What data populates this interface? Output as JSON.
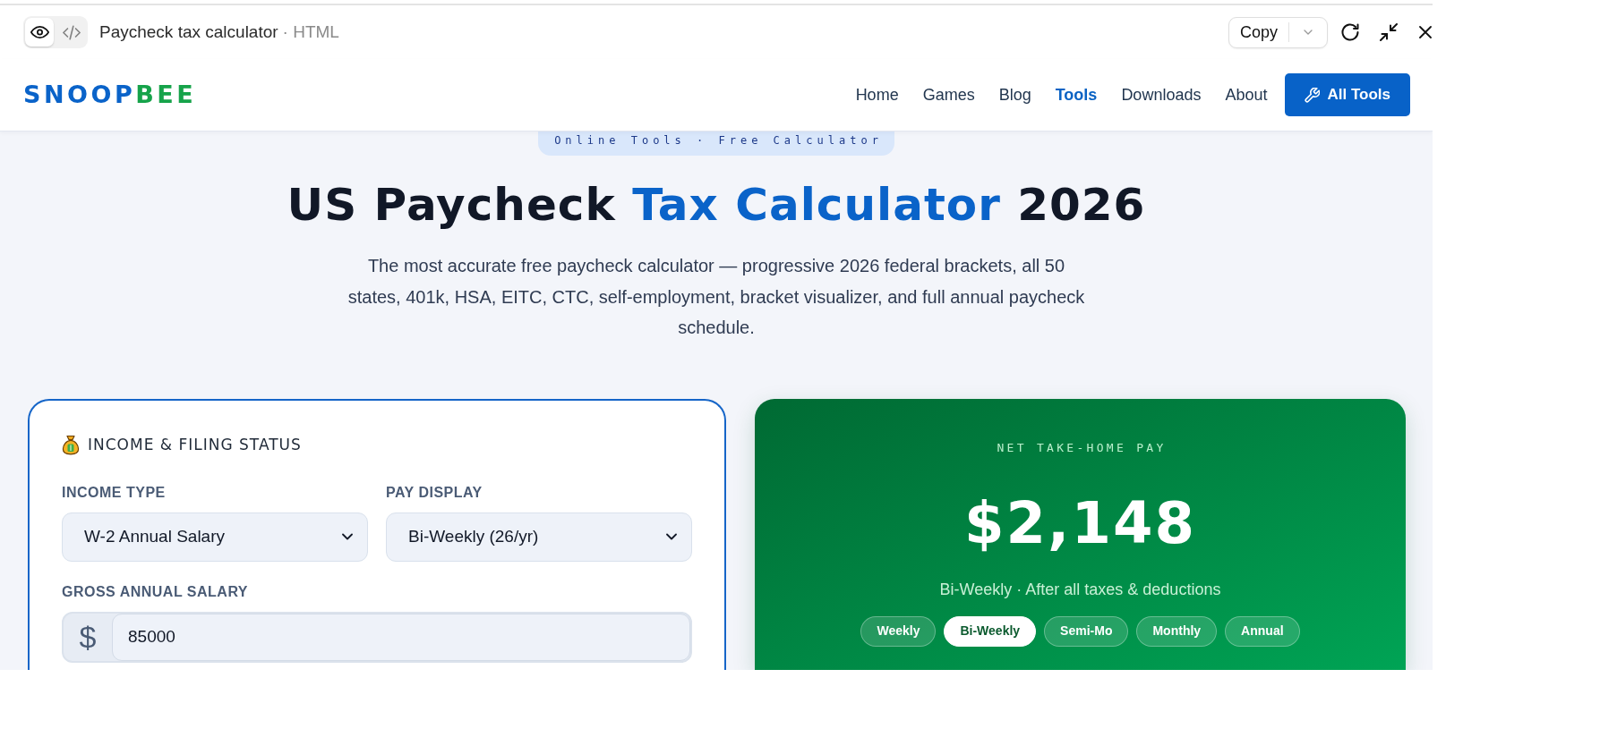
{
  "toolbar": {
    "view_modes": [
      {
        "kind": "preview",
        "selected": true
      },
      {
        "kind": "code",
        "selected": false
      }
    ],
    "title": "Paycheck tax calculator",
    "file_type": "· HTML",
    "copy_label": "Copy"
  },
  "nav": {
    "logo": [
      {
        "text": "SNOOP",
        "color": "#0a63c9"
      },
      {
        "text": "BEE",
        "color": "#16a34a"
      }
    ],
    "links": [
      {
        "label": "Home",
        "selected": false
      },
      {
        "label": "Games",
        "selected": false
      },
      {
        "label": "Blog",
        "selected": false
      },
      {
        "label": "Tools",
        "selected": true
      },
      {
        "label": "Downloads",
        "selected": false
      },
      {
        "label": "About",
        "selected": false
      }
    ],
    "cta": "All Tools"
  },
  "hero": {
    "badge": "Online Tools · Free Calculator",
    "title": [
      {
        "text": "US Paycheck",
        "highlight": false
      },
      {
        "text": "Tax Calculator",
        "highlight": true
      },
      {
        "text": "2026",
        "highlight": false
      }
    ],
    "subtitle": "The most accurate free paycheck calculator — progressive 2026 federal brackets, all 50 states, 401k, HSA, EITC, CTC, self-employment, bracket visualizer, and full annual paycheck schedule."
  },
  "income_card": {
    "heading": "INCOME & FILING STATUS",
    "fields": [
      {
        "kind": "select",
        "label": "INCOME TYPE",
        "value": "W-2 Annual Salary"
      },
      {
        "kind": "select",
        "label": "PAY DISPLAY",
        "value": "Bi-Weekly (26/yr)"
      },
      {
        "kind": "currency",
        "label": "GROSS ANNUAL SALARY",
        "prefix": "$",
        "value": "85000"
      }
    ]
  },
  "result_card": {
    "label": "NET TAKE-HOME PAY",
    "amount": "$2,148",
    "caption": "Bi-Weekly · After all taxes & deductions",
    "periods": [
      {
        "label": "Weekly",
        "selected": false
      },
      {
        "label": "Bi-Weekly",
        "selected": true
      },
      {
        "label": "Semi-Mo",
        "selected": false
      },
      {
        "label": "Monthly",
        "selected": false
      },
      {
        "label": "Annual",
        "selected": false
      }
    ]
  }
}
